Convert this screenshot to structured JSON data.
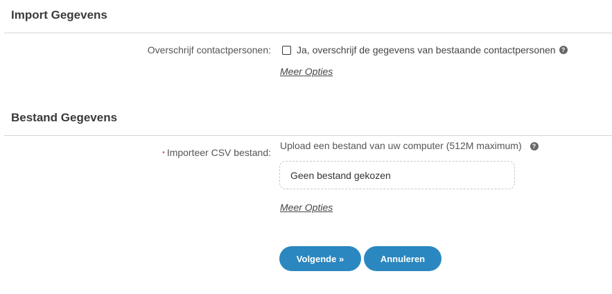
{
  "import_section": {
    "title": "Import Gegevens",
    "overwrite_label": "Overschrijf contactpersonen:",
    "overwrite_checkbox_label": "Ja, overschrijf de gegevens van bestaande contactpersonen",
    "overwrite_checked": false,
    "more_options": "Meer Opties"
  },
  "file_section": {
    "title": "Bestand Gegevens",
    "required_marker": "•",
    "csv_label": "Importeer CSV bestand:",
    "upload_hint": "Upload een bestand van uw computer (512M maximum)",
    "file_placeholder": "Geen bestand gekozen",
    "more_options": "Meer Opties"
  },
  "help_glyph": "?",
  "buttons": {
    "next_label": "Volgende »",
    "cancel_label": "Annuleren"
  },
  "colors": {
    "button_bg": "#2b87bf",
    "divider": "#d4d4d4",
    "required": "#d9534f"
  }
}
